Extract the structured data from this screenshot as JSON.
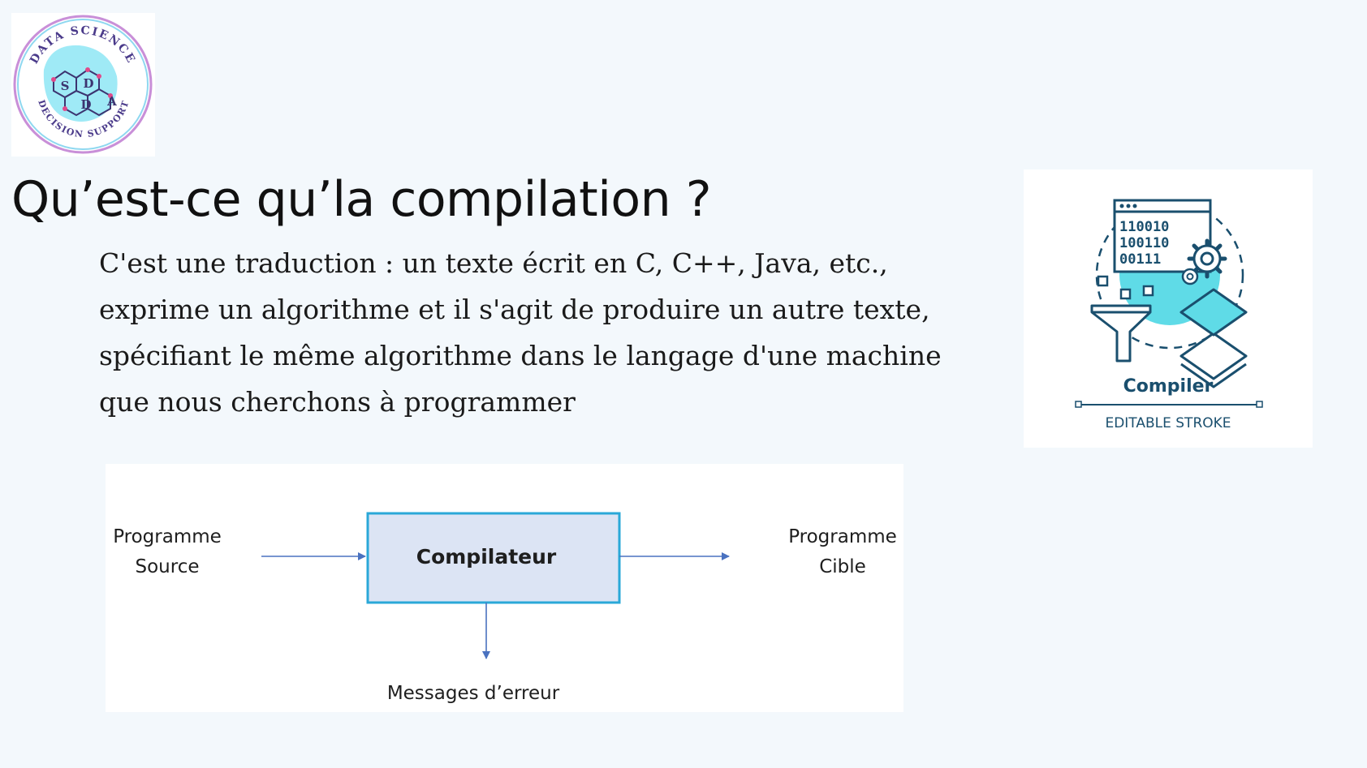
{
  "logo": {
    "ring_top": "DATA SCIENCE",
    "ring_bottom": "DECISION SUPPORT",
    "letters": [
      "S",
      "D",
      "A",
      "D"
    ]
  },
  "slide": {
    "title": "Qu’est-ce qu’la compilation ?",
    "paragraph_lines": [
      "C'est une traduction : un texte écrit en C, C++, Java, etc.,",
      "exprime un algorithme et il s'agit de produire un autre texte,",
      "spécifiant le même algorithme dans le langage d'une machine",
      "que nous cherchons à programmer"
    ]
  },
  "compiler_icon": {
    "binary_lines": [
      "110010",
      "100110",
      "00111"
    ],
    "label": "Compiler",
    "caption": "EDITABLE STROKE",
    "colors": {
      "stroke": "#1a4f6e",
      "accent": "#5fdbe7"
    }
  },
  "diagram": {
    "source_line1": "Programme",
    "source_line2": "Source",
    "box_label": "Compilateur",
    "target_line1": "Programme",
    "target_line2": "Cible",
    "errors_label": "Messages d’erreur",
    "colors": {
      "box_fill": "#dce4f4",
      "box_border": "#2aa8d8",
      "arrow": "#4a72c0"
    }
  }
}
